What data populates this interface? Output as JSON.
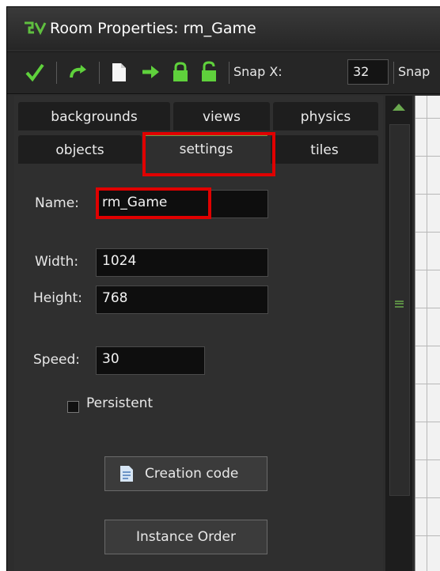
{
  "window": {
    "title": "Room Properties: rm_Game"
  },
  "toolbar": {
    "icons": [
      "checkmark-icon",
      "undo-icon",
      "new-page-icon",
      "arrow-right-icon",
      "lock-icon",
      "unlock-icon"
    ],
    "snapx_label": "Snap X:",
    "snapx_value": "32",
    "snapy_label": "Snap"
  },
  "tabs": {
    "backgrounds": "backgrounds",
    "views": "views",
    "physics": "physics",
    "objects": "objects",
    "settings": "settings",
    "tiles": "tiles",
    "active": "settings"
  },
  "settings": {
    "name_label": "Name:",
    "name_value": "rm_Game",
    "width_label": "Width:",
    "width_value": "1024",
    "height_label": "Height:",
    "height_value": "768",
    "speed_label": "Speed:",
    "speed_value": "30",
    "persistent_label": "Persistent",
    "persistent_checked": false,
    "creation_code_label": "Creation code",
    "instance_order_label": "Instance Order"
  },
  "colors": {
    "accent": "#6aa84f",
    "highlight": "#e00000",
    "panel": "#2f2f2f"
  }
}
